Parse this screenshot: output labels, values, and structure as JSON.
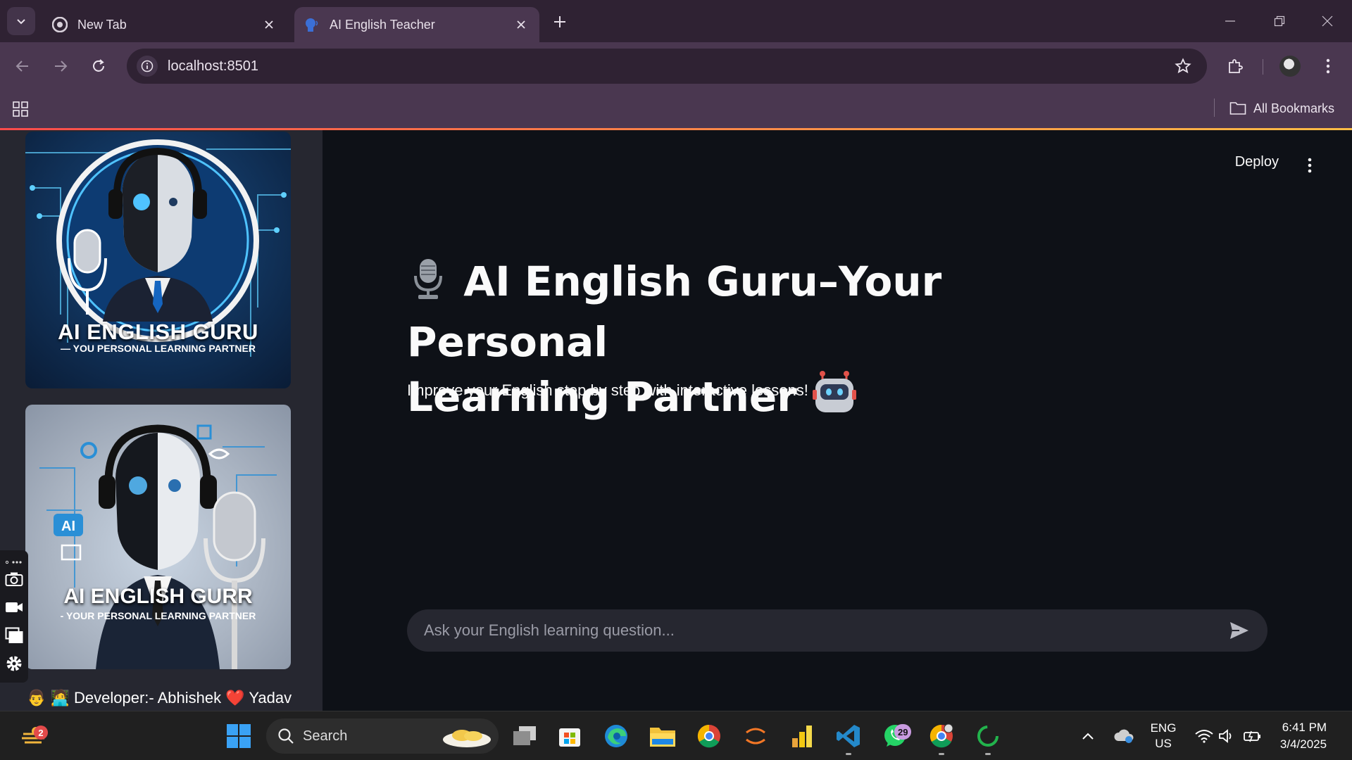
{
  "browser": {
    "tabs": [
      {
        "title": "New Tab",
        "active": false
      },
      {
        "title": "AI English Teacher",
        "active": true
      }
    ],
    "url": "localhost:8501",
    "bookmarks_label": "All Bookmarks"
  },
  "app": {
    "deploy_label": "Deploy",
    "title_part1": "AI English Guru–Your Personal",
    "title_part2": "Learning Partner",
    "title_emoji_start": "microphone",
    "title_emoji_end": "robot",
    "subtitle": "Improve your English step by step with interactive lessons!",
    "chat_placeholder": "Ask your English learning question...",
    "accent_color": "#ff4b4b"
  },
  "sidebar": {
    "image1": {
      "title": "AI ENGLISH GURU",
      "subtitle": "— YOU PERSONAL LEARNING PARTNER"
    },
    "image2": {
      "title": "AI ENGLISH GURR",
      "subtitle": "- YOUR PERSONAL LEARNING PARTNER",
      "badge": "AI"
    },
    "developer_credit": "👨 🧑‍💻 Developer:- Abhishek ❤️ Yadav"
  },
  "taskbar": {
    "weather_badge": "2",
    "search_label": "Search",
    "whatsapp_badge": "29",
    "language_top": "ENG",
    "language_bottom": "US",
    "time": "6:41 PM",
    "date": "3/4/2025"
  }
}
